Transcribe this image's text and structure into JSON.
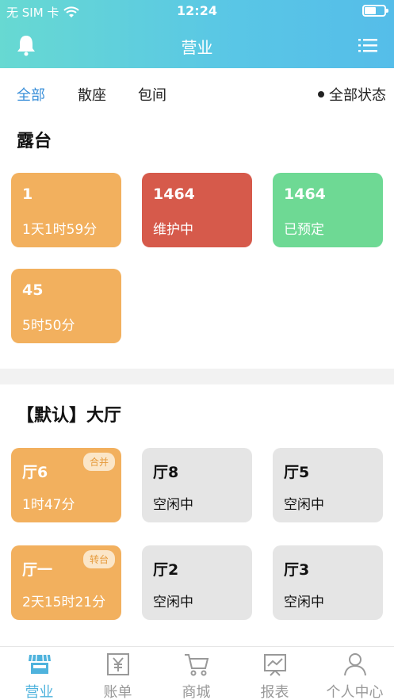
{
  "status_bar": {
    "carrier": "无 SIM 卡",
    "time": "12:24"
  },
  "nav": {
    "title": "营业"
  },
  "filters": {
    "tabs": [
      {
        "label": "全部",
        "active": true
      },
      {
        "label": "散座",
        "active": false
      },
      {
        "label": "包间",
        "active": false
      }
    ],
    "status_label": "全部状态"
  },
  "sections": [
    {
      "title": "露台",
      "tables": [
        {
          "name": "1",
          "status": "1天1时59分",
          "color": "#f2b05e"
        },
        {
          "name": "1464",
          "status": "维护中",
          "color": "#d65a4b"
        },
        {
          "name": "1464",
          "status": "已预定",
          "color": "#6ed994"
        },
        {
          "name": "45",
          "status": "5时50分",
          "color": "#f2b05e"
        }
      ]
    },
    {
      "title": "【默认】大厅",
      "tables": [
        {
          "name": "厅6",
          "status": "1时47分",
          "tag": "合并",
          "color": "#f2b05e"
        },
        {
          "name": "厅8",
          "status": "空闲中",
          "color": "#e5e5e5"
        },
        {
          "name": "厅5",
          "status": "空闲中",
          "color": "#e5e5e5"
        },
        {
          "name": "厅一",
          "status": "2天15时21分",
          "tag": "转台",
          "color": "#f2b05e"
        },
        {
          "name": "厅2",
          "status": "空闲中",
          "color": "#e5e5e5"
        },
        {
          "name": "厅3",
          "status": "空闲中",
          "color": "#e5e5e5"
        }
      ]
    }
  ],
  "tabbar": {
    "items": [
      {
        "label": "营业",
        "icon": "store-icon",
        "active": true
      },
      {
        "label": "账单",
        "icon": "yen-bill-icon",
        "active": false
      },
      {
        "label": "商城",
        "icon": "cart-icon",
        "active": false
      },
      {
        "label": "报表",
        "icon": "chart-board-icon",
        "active": false
      },
      {
        "label": "个人中心",
        "icon": "person-icon",
        "active": false
      }
    ]
  },
  "colors": {
    "accent": "#3a8fd9",
    "tab_active": "#4fb3dd",
    "header_start": "#67d9d2",
    "header_end": "#55bde9"
  }
}
